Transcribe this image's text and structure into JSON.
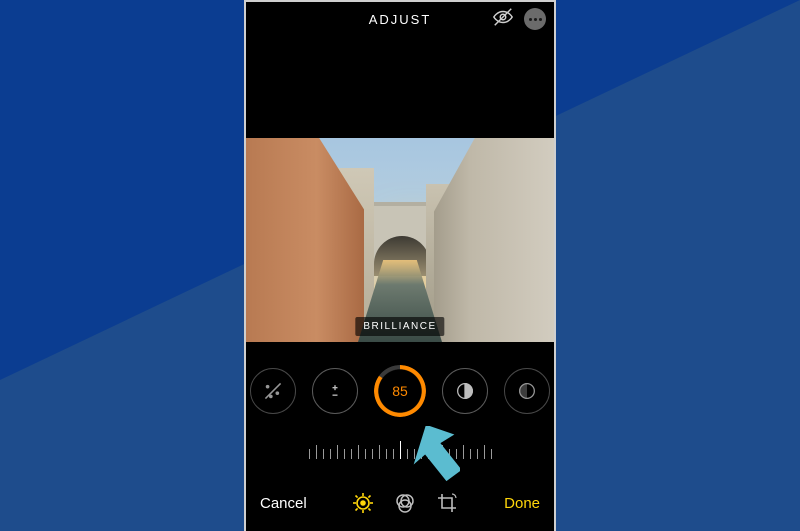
{
  "header": {
    "title": "ADJUST"
  },
  "adjustment": {
    "current_label": "BRILLIANCE",
    "current_value": "85"
  },
  "footer": {
    "cancel": "Cancel",
    "done": "Done"
  },
  "colors": {
    "accent": "#ff8a00",
    "done": "#ffd60a"
  }
}
